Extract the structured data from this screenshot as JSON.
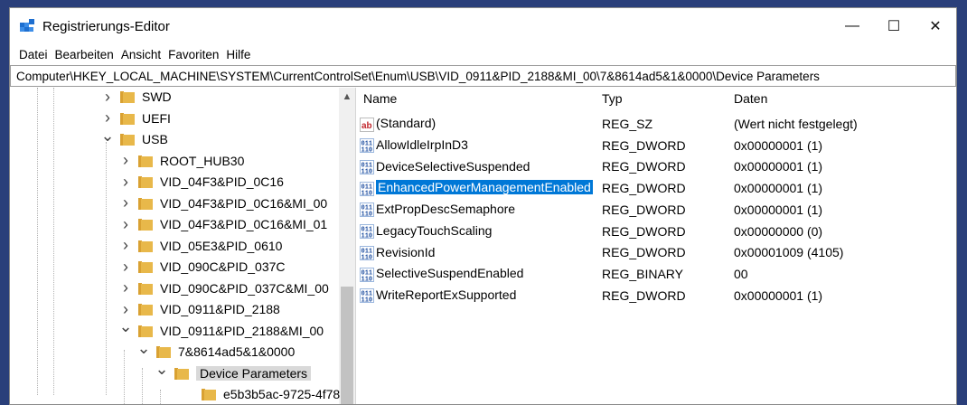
{
  "window": {
    "title": "Registrierungs-Editor",
    "controls": {
      "minimize": "—",
      "maximize": "☐",
      "close": "✕"
    }
  },
  "menu": [
    "Datei",
    "Bearbeiten",
    "Ansicht",
    "Favoriten",
    "Hilfe"
  ],
  "address": "Computer\\HKEY_LOCAL_MACHINE\\SYSTEM\\CurrentControlSet\\Enum\\USB\\VID_0911&PID_2188&MI_00\\7&8614ad5&1&0000\\Device Parameters",
  "tree": [
    {
      "label": "SWD",
      "chevron": "right"
    },
    {
      "label": "UEFI",
      "chevron": "right"
    },
    {
      "label": "USB",
      "chevron": "down"
    },
    {
      "label": "ROOT_HUB30",
      "chevron": "right"
    },
    {
      "label": "VID_04F3&PID_0C16",
      "chevron": "right"
    },
    {
      "label": "VID_04F3&PID_0C16&MI_00",
      "chevron": "right"
    },
    {
      "label": "VID_04F3&PID_0C16&MI_01",
      "chevron": "right"
    },
    {
      "label": "VID_05E3&PID_0610",
      "chevron": "right"
    },
    {
      "label": "VID_090C&PID_037C",
      "chevron": "right"
    },
    {
      "label": "VID_090C&PID_037C&MI_00",
      "chevron": "right"
    },
    {
      "label": "VID_0911&PID_2188",
      "chevron": "right"
    },
    {
      "label": "VID_0911&PID_2188&MI_00",
      "chevron": "down"
    },
    {
      "label": "7&8614ad5&1&0000",
      "chevron": "down"
    },
    {
      "label": "Device Parameters",
      "chevron": "down",
      "selected": true
    },
    {
      "label": "e5b3b5ac-9725-4f78",
      "chevron": "none"
    }
  ],
  "columns": {
    "name": "Name",
    "type": "Typ",
    "data": "Daten"
  },
  "values": [
    {
      "icon": "string-value-icon",
      "name": "(Standard)",
      "type": "REG_SZ",
      "data": "(Wert nicht festgelegt)"
    },
    {
      "icon": "binary-value-icon",
      "name": "AllowIdleIrpInD3",
      "type": "REG_DWORD",
      "data": "0x00000001 (1)"
    },
    {
      "icon": "binary-value-icon",
      "name": "DeviceSelectiveSuspended",
      "type": "REG_DWORD",
      "data": "0x00000001 (1)"
    },
    {
      "icon": "binary-value-icon",
      "name": "EnhancedPowerManagementEnabled",
      "type": "REG_DWORD",
      "data": "0x00000001 (1)",
      "selected": true
    },
    {
      "icon": "binary-value-icon",
      "name": "ExtPropDescSemaphore",
      "type": "REG_DWORD",
      "data": "0x00000001 (1)"
    },
    {
      "icon": "binary-value-icon",
      "name": "LegacyTouchScaling",
      "type": "REG_DWORD",
      "data": "0x00000000 (0)"
    },
    {
      "icon": "binary-value-icon",
      "name": "RevisionId",
      "type": "REG_DWORD",
      "data": "0x00001009 (4105)"
    },
    {
      "icon": "binary-value-icon",
      "name": "SelectiveSuspendEnabled",
      "type": "REG_BINARY",
      "data": "00"
    },
    {
      "icon": "binary-value-icon",
      "name": "WriteReportExSupported",
      "type": "REG_DWORD",
      "data": "0x00000001 (1)"
    }
  ],
  "colors": {
    "selection": "#0078d7",
    "folder": "#e8b84a",
    "desktop": "#2a3f7a"
  }
}
